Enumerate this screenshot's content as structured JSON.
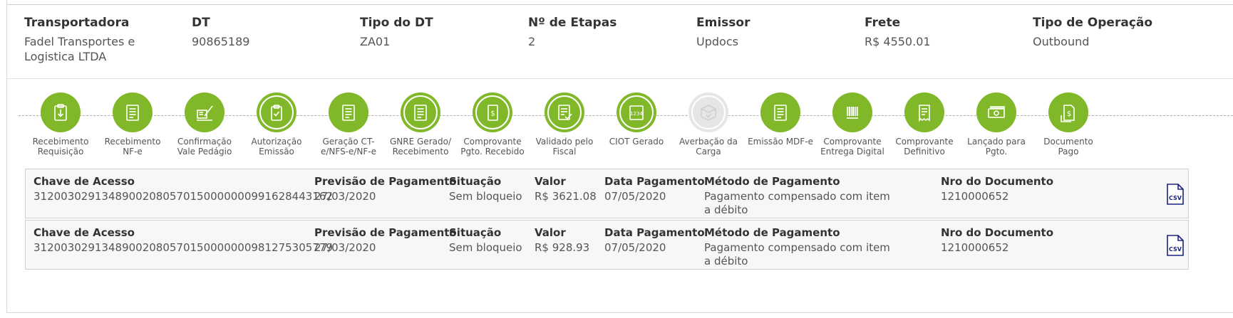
{
  "header": {
    "fields": [
      {
        "label": "Transportadora",
        "value": "Fadel Transportes e\nLogistica LTDA"
      },
      {
        "label": "DT",
        "value": "90865189"
      },
      {
        "label": "Tipo do DT",
        "value": "ZA01"
      },
      {
        "label": "Nº de Etapas",
        "value": "2"
      },
      {
        "label": "Emissor",
        "value": "Updocs"
      },
      {
        "label": "Frete",
        "value": "R$ 4550.01"
      },
      {
        "label": "Tipo de Operação",
        "value": "Outbound"
      }
    ]
  },
  "colors": {
    "accent": "#80b829",
    "inactive": "#e6e6e6",
    "csv_icon": "#1a237e"
  },
  "steps": [
    {
      "label": "Recebimento\nRequisição",
      "icon": "clipboard-download-icon",
      "state": "done"
    },
    {
      "label": "Recebimento\nNF-e",
      "icon": "document-list-icon",
      "state": "done"
    },
    {
      "label": "Confirmação\nVale Pedágio",
      "icon": "truck-pen-icon",
      "state": "done"
    },
    {
      "label": "Autorização\nEmissão",
      "icon": "clipboard-check-icon",
      "state": "current"
    },
    {
      "label": "Geração CT-\ne/NFS-e/NF-e",
      "icon": "document-list-icon",
      "state": "done"
    },
    {
      "label": "GNRE Gerado/\nRecebimento",
      "icon": "document-list-icon",
      "state": "current"
    },
    {
      "label": "Comprovante\nPgto. Recebido",
      "icon": "dollar-receipt-icon",
      "state": "current"
    },
    {
      "label": "Validado pelo\nFiscal",
      "icon": "document-check-icon",
      "state": "current"
    },
    {
      "label": "CIOT Gerado",
      "icon": "ciot-card-icon",
      "state": "current",
      "badge": "1234"
    },
    {
      "label": "Averbação da\nCarga",
      "icon": "box-check-icon",
      "state": "pending"
    },
    {
      "label": "Emissão MDF-e",
      "icon": "document-list-icon",
      "state": "done"
    },
    {
      "label": "Comprovante\nEntrega Digital",
      "icon": "barcode-icon",
      "state": "done"
    },
    {
      "label": "Comprovante\nDefinitivo",
      "icon": "receipt-icon",
      "state": "done"
    },
    {
      "label": "Lançado para\nPgto.",
      "icon": "banknote-icon",
      "state": "done"
    },
    {
      "label": "Documento\nPago",
      "icon": "dollar-document-icon",
      "state": "done"
    }
  ],
  "payments_labels": {
    "chave": "Chave de Acesso",
    "previsao": "Previsão de Pagamento",
    "situacao": "Situação",
    "valor": "Valor",
    "data": "Data Pagamento",
    "metodo": "Método de Pagamento",
    "nro": "Nro do Documento",
    "csv": "CSV"
  },
  "payments": [
    {
      "chave": "31200302913489002080570150000000991628443162",
      "previsao": "27/03/2020",
      "situacao": "Sem bloqueio",
      "valor": "R$ 3621.08",
      "data": "07/05/2020",
      "metodo": "Pagamento compensado com item\na débito",
      "nro": "1210000652"
    },
    {
      "chave": "31200302913489002080570150000000981275305779",
      "previsao": "27/03/2020",
      "situacao": "Sem bloqueio",
      "valor": "R$ 928.93",
      "data": "07/05/2020",
      "metodo": "Pagamento compensado com item\na débito",
      "nro": "1210000652"
    }
  ]
}
